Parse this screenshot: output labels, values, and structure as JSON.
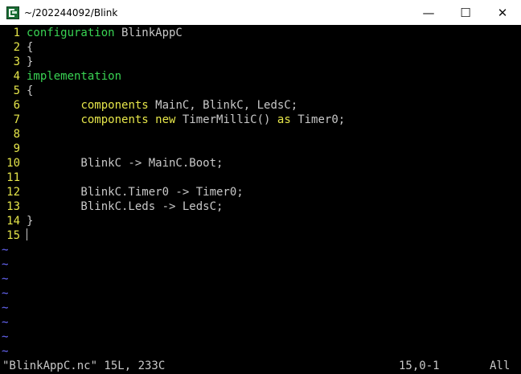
{
  "window": {
    "title": "~/202244092/Blink",
    "controls": {
      "minimize": "—",
      "maximize": "☐",
      "close": "✕"
    }
  },
  "editor": {
    "lines": [
      {
        "n": "1",
        "parts": [
          [
            "kw-green",
            "configuration"
          ],
          [
            "txt",
            " BlinkAppC"
          ]
        ]
      },
      {
        "n": "2",
        "parts": [
          [
            "txt",
            "{"
          ]
        ]
      },
      {
        "n": "3",
        "parts": [
          [
            "txt",
            "}"
          ]
        ]
      },
      {
        "n": "4",
        "parts": [
          [
            "kw-green",
            "implementation"
          ]
        ]
      },
      {
        "n": "5",
        "parts": [
          [
            "txt",
            "{"
          ]
        ]
      },
      {
        "n": "6",
        "parts": [
          [
            "txt",
            "        "
          ],
          [
            "kw-yellow",
            "components"
          ],
          [
            "txt",
            " MainC, BlinkC, LedsC;"
          ]
        ]
      },
      {
        "n": "7",
        "parts": [
          [
            "txt",
            "        "
          ],
          [
            "kw-yellow",
            "components"
          ],
          [
            "txt",
            " "
          ],
          [
            "kw-yellow",
            "new"
          ],
          [
            "txt",
            " TimerMilliC() "
          ],
          [
            "kw-yellow",
            "as"
          ],
          [
            "txt",
            " Timer0;"
          ]
        ]
      },
      {
        "n": "8",
        "parts": []
      },
      {
        "n": "9",
        "parts": []
      },
      {
        "n": "10",
        "parts": [
          [
            "txt",
            "        BlinkC -> MainC.Boot;"
          ]
        ]
      },
      {
        "n": "11",
        "parts": []
      },
      {
        "n": "12",
        "parts": [
          [
            "txt",
            "        BlinkC.Timer0 -> Timer0;"
          ]
        ]
      },
      {
        "n": "13",
        "parts": [
          [
            "txt",
            "        BlinkC.Leds -> LedsC;"
          ]
        ]
      },
      {
        "n": "14",
        "parts": [
          [
            "txt",
            "}"
          ]
        ]
      },
      {
        "n": "15",
        "parts": [],
        "cursor": true
      }
    ],
    "tilde_char": "~",
    "tilde_count": 8
  },
  "status": {
    "file_info": "\"BlinkAppC.nc\" 15L, 233C",
    "position": "15,0-1",
    "scroll": "All"
  }
}
